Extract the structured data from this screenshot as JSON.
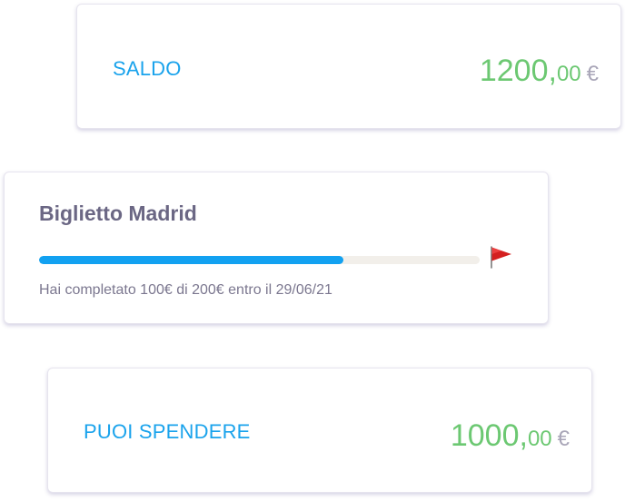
{
  "colors": {
    "label_blue": "#1aa3ec",
    "amount_green": "#6cc872",
    "currency_gray": "#a9a6b8",
    "title_text": "#6b6784",
    "sub_text": "#7b778f",
    "progress_fill": "#12a1f1",
    "progress_track": "#f2efea",
    "flag_red": "#d42020"
  },
  "saldo": {
    "label": "SALDO",
    "amount_int": "1200,",
    "amount_dec": "00",
    "currency": "€"
  },
  "goal": {
    "title": "Biglietto Madrid",
    "progress": 0.69,
    "subtitle": "Hai completato 100€ di 200€ entro il 29/06/21",
    "flag_icon": "flag-icon"
  },
  "spend": {
    "label": "PUOI SPENDERE",
    "amount_int": "1000,",
    "amount_dec": "00",
    "currency": "€"
  }
}
